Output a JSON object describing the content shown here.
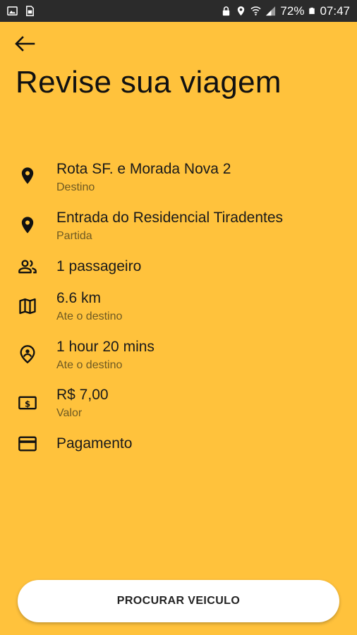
{
  "status_bar": {
    "battery": "72%",
    "time": "07:47"
  },
  "page": {
    "title": "Revise sua viagem"
  },
  "details": [
    {
      "icon": "location-pin-icon",
      "primary": "Rota SF. e Morada Nova 2",
      "secondary": "Destino"
    },
    {
      "icon": "location-pin-icon",
      "primary": "Entrada do Residencial Tiradentes",
      "secondary": "Partida"
    },
    {
      "icon": "people-icon",
      "primary": "1 passageiro",
      "secondary": ""
    },
    {
      "icon": "map-icon",
      "primary": "6.6 km",
      "secondary": "Ate o destino"
    },
    {
      "icon": "person-pin-icon",
      "primary": "1 hour 20 mins",
      "secondary": "Ate o destino"
    },
    {
      "icon": "money-icon",
      "primary": "R$ 7,00",
      "secondary": "Valor"
    },
    {
      "icon": "credit-card-icon",
      "primary": "Pagamento",
      "secondary": ""
    }
  ],
  "action": {
    "button_label": "PROCURAR VEICULO"
  },
  "colors": {
    "background": "#FFC23C",
    "status_bar": "#2b2b2b",
    "button": "#FFFFFF"
  }
}
